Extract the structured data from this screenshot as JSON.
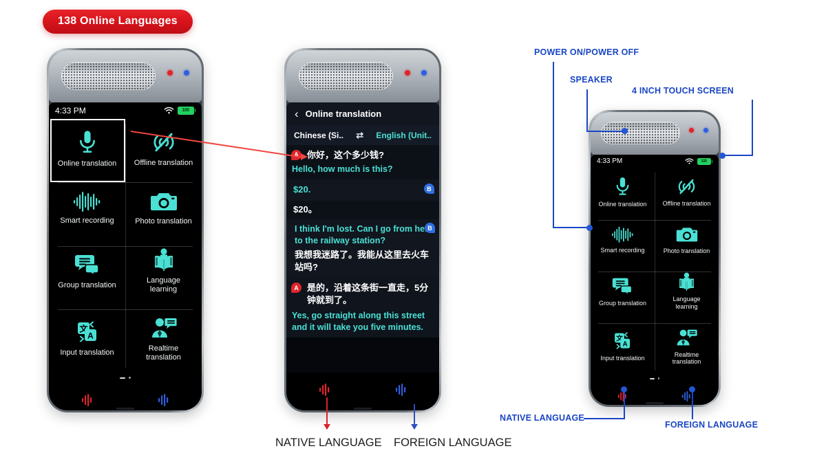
{
  "badge": {
    "label": "138 Online Languages",
    "color": "#d4121a"
  },
  "theme": {
    "accent_cyan": "#4ae0d4",
    "callout_blue": "#1a46c4",
    "red": "#e0242b",
    "blue": "#2f5fe0",
    "battery_green": "#23d15f"
  },
  "status_bar": {
    "time": "4:33 PM",
    "wifi_icon": "wifi-icon",
    "battery_icon": "battery-icon",
    "battery_level": "100"
  },
  "home_screen": {
    "apps": [
      {
        "label": "Online translation",
        "icon": "microphone-icon"
      },
      {
        "label": "Offline translation",
        "icon": "microphone-off-icon"
      },
      {
        "label": "Smart recording",
        "icon": "waveform-icon"
      },
      {
        "label": "Photo translation",
        "icon": "camera-icon"
      },
      {
        "label": "Group translation",
        "icon": "chat-bubbles-icon"
      },
      {
        "label": "Language\nlearning",
        "icon": "open-book-icon"
      },
      {
        "label": "Input translation",
        "icon": "text-translate-icon"
      },
      {
        "label": "Realtime\ntranslation",
        "icon": "person-speech-icon"
      }
    ],
    "selected_app": "Online translation",
    "page_indicator": {
      "current": 1,
      "total": 2
    },
    "bottom_buttons": [
      {
        "name": "native-language-button",
        "icon": "waveform-icon",
        "color": "#e0242b"
      },
      {
        "name": "foreign-language-button",
        "icon": "waveform-icon",
        "color": "#2f5fe0"
      }
    ]
  },
  "chat_screen": {
    "back_icon": "chevron-left-icon",
    "title": "Online translation",
    "source_language": "Chinese (Si..",
    "swap_icon": "swap-arrows-icon",
    "target_language": "English (Unit..",
    "messages": [
      {
        "speaker": "A",
        "badge": "A",
        "original": "你好，这个多少钱?",
        "translation": "Hello, how much is this?"
      },
      {
        "speaker": "B",
        "badge": "B",
        "original": "$20.",
        "translation": "$20。"
      },
      {
        "speaker": "B",
        "badge": "B",
        "original": "I think I'm lost. Can I go from here to the railway station?",
        "translation": "我想我迷路了。我能从这里去火车站吗?"
      },
      {
        "speaker": "A",
        "badge": "A",
        "original": "是的，沿着这条街一直走，5分钟就到了。",
        "translation": "Yes, go straight along this street and it will take you five minutes."
      }
    ]
  },
  "bottom_labels": {
    "native": "NATIVE LANGUAGE",
    "foreign": "FOREIGN LANGUAGE"
  },
  "callouts": [
    {
      "id": "power",
      "label": "POWER ON/POWER OFF"
    },
    {
      "id": "speaker",
      "label": "SPEAKER"
    },
    {
      "id": "screen",
      "label": "4 INCH TOUCH SCREEN"
    },
    {
      "id": "native",
      "label": "NATIVE LANGUAGE"
    },
    {
      "id": "foreign",
      "label": "FOREIGN LANGUAGE"
    }
  ]
}
